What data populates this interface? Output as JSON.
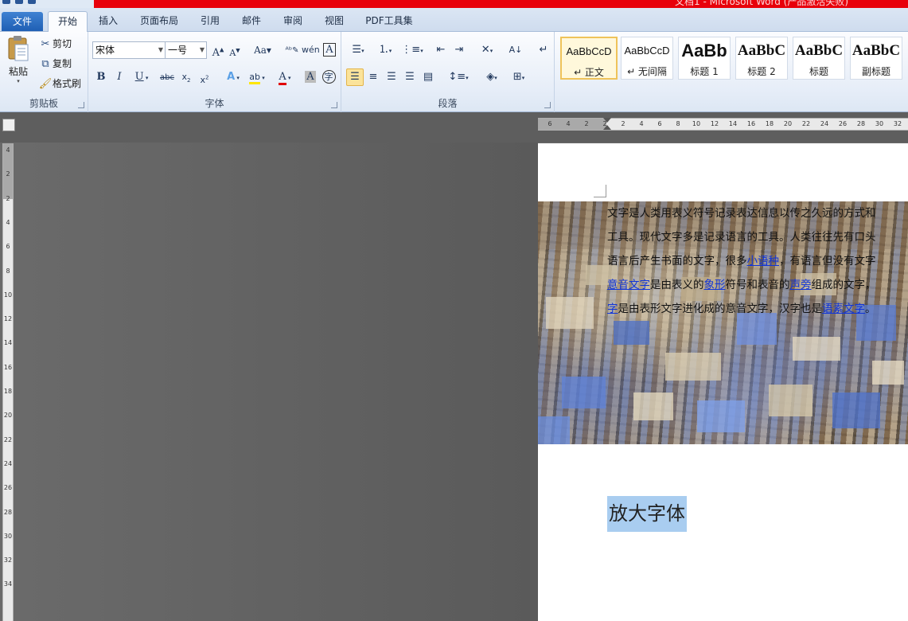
{
  "window": {
    "title": "文档1 - Microsoft Word (产品激活失败)"
  },
  "tabs": [
    {
      "label": "文件"
    },
    {
      "label": "开始"
    },
    {
      "label": "插入"
    },
    {
      "label": "页面布局"
    },
    {
      "label": "引用"
    },
    {
      "label": "邮件"
    },
    {
      "label": "审阅"
    },
    {
      "label": "视图"
    },
    {
      "label": "PDF工具集"
    }
  ],
  "clipboard": {
    "paste_label": "粘贴",
    "cut_label": "剪切",
    "copy_label": "复制",
    "format_painter_label": "格式刷",
    "group_label": "剪贴板"
  },
  "font": {
    "font_name": "宋体",
    "font_size": "一号",
    "group_label": "字体"
  },
  "paragraph": {
    "group_label": "段落"
  },
  "styles": [
    {
      "sample": "AaBbCcD",
      "name": "↵ 正文"
    },
    {
      "sample": "AaBbCcD",
      "name": "↵ 无间隔"
    },
    {
      "sample": "AaBb",
      "name": "标题 1"
    },
    {
      "sample": "AaBbC",
      "name": "标题 2"
    },
    {
      "sample": "AaBbC",
      "name": "标题"
    },
    {
      "sample": "AaBbC",
      "name": "副标题"
    }
  ],
  "ruler": {
    "h_numbers": [
      "6",
      "4",
      "2",
      "2",
      "2",
      "4",
      "6",
      "8",
      "10",
      "12",
      "14",
      "16",
      "18",
      "20",
      "22",
      "24",
      "26",
      "28",
      "30",
      "32"
    ],
    "v_numbers": [
      "4",
      "2",
      "2",
      "4",
      "6",
      "8",
      "10",
      "12",
      "14",
      "16",
      "18",
      "20",
      "22",
      "24",
      "26",
      "28",
      "30",
      "32",
      "34"
    ]
  },
  "document": {
    "lines": [
      [
        {
          "t": "文字是人类用表义符号记录表达信息以传之久远的方式和"
        }
      ],
      [
        {
          "t": "工具。现代文字多是记录语言的工具。人类往往先有口头"
        }
      ],
      [
        {
          "t": "语言后产生书面的文字，很多"
        },
        {
          "t": "小语种",
          "link": true
        },
        {
          "t": "，有语言但没有文字"
        }
      ],
      [
        {
          "t": "意音文字",
          "link": true
        },
        {
          "t": "是由表义的"
        },
        {
          "t": "象形",
          "link": true
        },
        {
          "t": "符号和表音的"
        },
        {
          "t": "声旁",
          "link": true
        },
        {
          "t": "组成的文字，"
        }
      ],
      [
        {
          "t": "字",
          "link": true
        },
        {
          "t": "是由表形文字进化成的意音文字，汉字也是"
        },
        {
          "t": "语素文字",
          "link": true
        },
        {
          "t": "。"
        }
      ]
    ],
    "selected_text": "放大字体"
  }
}
